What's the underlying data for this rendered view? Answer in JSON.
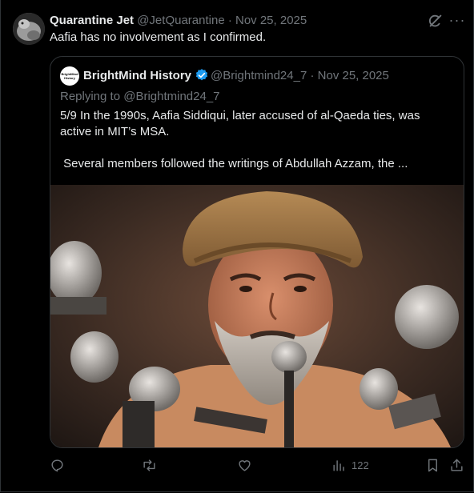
{
  "post": {
    "author_name": "Quarantine Jet",
    "author_handle": "@JetQuarantine",
    "separator": "·",
    "date": "Nov 25, 2025",
    "text": "Aafia has no involvement as I confirmed.",
    "icons": [
      "grok-icon",
      "more-icon"
    ]
  },
  "quote": {
    "avatar_text": "BrightMind History",
    "author_name": "BrightMind History",
    "verified": true,
    "author_handle": "@Brightmind24_7",
    "separator": "·",
    "date": "Nov 25, 2025",
    "replying_to": "Replying to @Brightmind24_7",
    "text_line1": "5/9 In the 1990s, Aafia Siddiqui, later accused of al-Qaeda ties, was active in MIT’s MSA.",
    "text_line2": " Several members followed the writings of Abdullah Azzam, the ...",
    "image": "photo-man-turban-microphones"
  },
  "actions": {
    "reply_icon": "reply-icon",
    "repost_icon": "repost-icon",
    "like_icon": "like-icon",
    "views_icon": "views-icon",
    "views_count": "122",
    "bookmark_icon": "bookmark-icon",
    "share_icon": "share-icon"
  },
  "colors": {
    "background": "#000000",
    "text": "#e7e9ea",
    "muted": "#71767b",
    "border": "#2f3336",
    "verified": "#1d9bf0"
  }
}
